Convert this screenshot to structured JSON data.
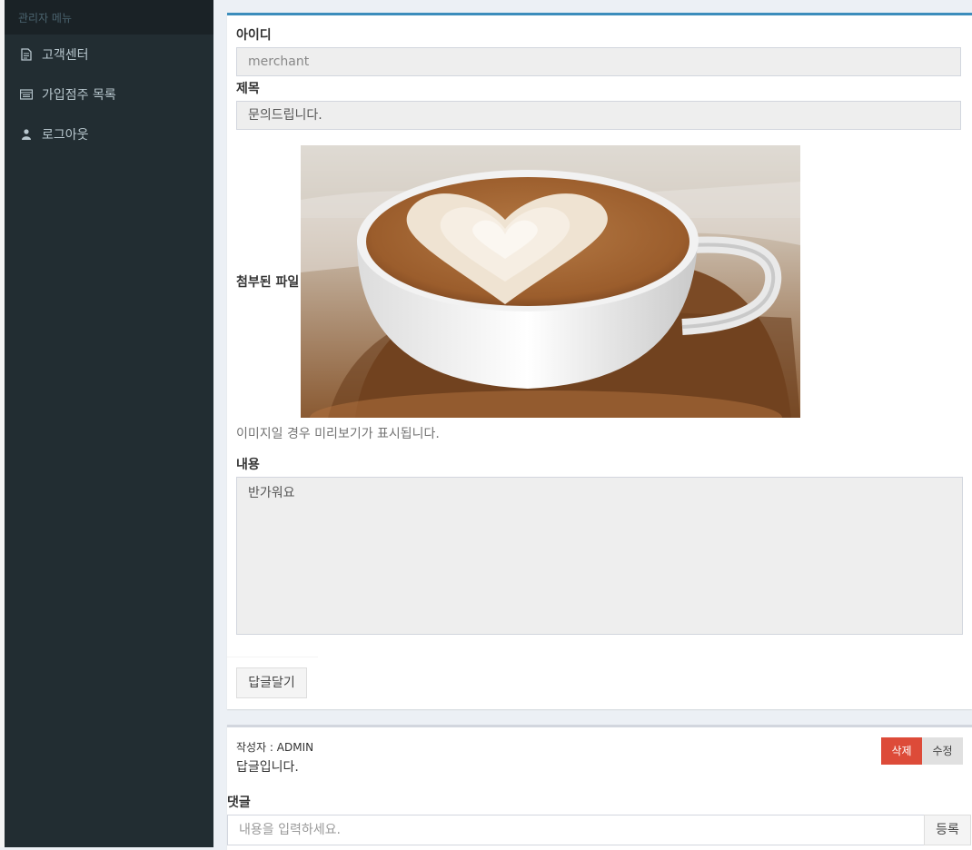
{
  "sidebar": {
    "header": "관리자 메뉴",
    "items": [
      {
        "label": "고객센터",
        "icon": "file-text-icon"
      },
      {
        "label": "가입점주 목록",
        "icon": "list-icon"
      },
      {
        "label": "로그아웃",
        "icon": "user-icon"
      }
    ]
  },
  "post": {
    "id_label": "아이디",
    "id_value": "merchant",
    "title_label": "제목",
    "title_value": "문의드립니다.",
    "attachment_label": "첨부된 파일",
    "attachment_image": "latte-art-coffee-cup",
    "attachment_help": "이미지일 경우 미리보기가 표시됩니다.",
    "content_label": "내용",
    "content_value": "반가워요",
    "reply_button": "답글달기"
  },
  "reply": {
    "writer": "작성자 : ADMIN",
    "text": "답글입니다.",
    "delete_button": "삭제",
    "edit_button": "수정"
  },
  "comment": {
    "label": "댓글",
    "placeholder": "내용을 입력하세요.",
    "submit_button": "등록"
  },
  "colors": {
    "sidebar_bg": "#222d32",
    "accent": "#3c8dbc",
    "danger": "#dd4b39",
    "background": "#ecf0f5"
  }
}
